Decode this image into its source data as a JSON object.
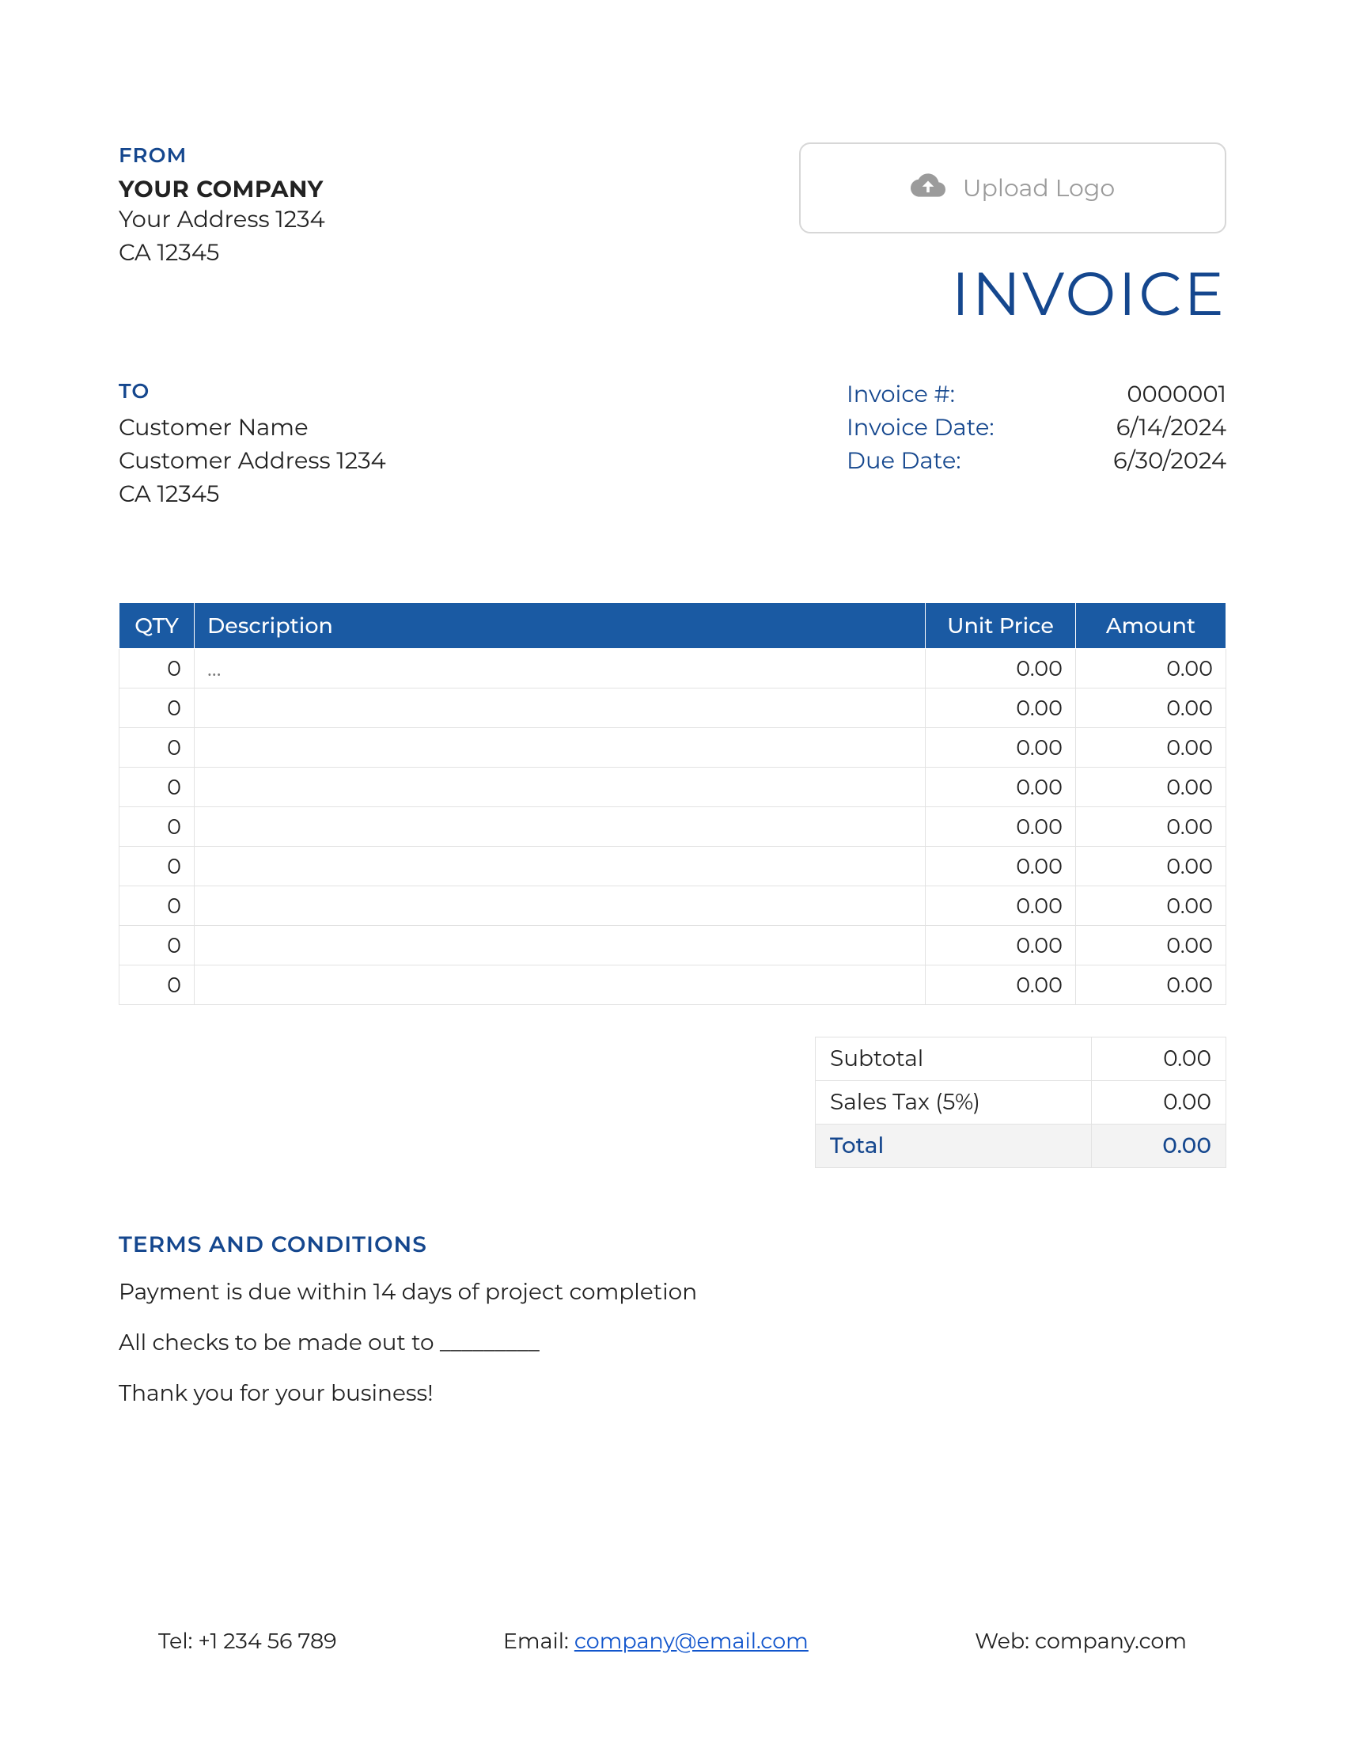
{
  "from": {
    "label": "FROM",
    "company": "YOUR COMPANY",
    "address": "Your Address 1234",
    "city": "CA 12345"
  },
  "logo": {
    "upload_label": "Upload Logo"
  },
  "doc_title": "INVOICE",
  "to": {
    "label": "TO",
    "name": "Customer Name",
    "address": "Customer Address 1234",
    "city": "CA 12345"
  },
  "meta": {
    "invoice_no_label": "Invoice #:",
    "invoice_no": "0000001",
    "invoice_date_label": "Invoice Date:",
    "invoice_date": "6/14/2024",
    "due_date_label": "Due Date:",
    "due_date": "6/30/2024"
  },
  "table": {
    "headers": {
      "qty": "QTY",
      "desc": "Description",
      "unit": "Unit Price",
      "amount": "Amount"
    },
    "rows": [
      {
        "qty": "0",
        "desc": "…",
        "unit": "0.00",
        "amount": "0.00"
      },
      {
        "qty": "0",
        "desc": "",
        "unit": "0.00",
        "amount": "0.00"
      },
      {
        "qty": "0",
        "desc": "",
        "unit": "0.00",
        "amount": "0.00"
      },
      {
        "qty": "0",
        "desc": "",
        "unit": "0.00",
        "amount": "0.00"
      },
      {
        "qty": "0",
        "desc": "",
        "unit": "0.00",
        "amount": "0.00"
      },
      {
        "qty": "0",
        "desc": "",
        "unit": "0.00",
        "amount": "0.00"
      },
      {
        "qty": "0",
        "desc": "",
        "unit": "0.00",
        "amount": "0.00"
      },
      {
        "qty": "0",
        "desc": "",
        "unit": "0.00",
        "amount": "0.00"
      },
      {
        "qty": "0",
        "desc": "",
        "unit": "0.00",
        "amount": "0.00"
      }
    ]
  },
  "totals": {
    "subtotal_label": "Subtotal",
    "subtotal": "0.00",
    "tax_label": "Sales Tax (5%)",
    "tax": "0.00",
    "total_label": "Total",
    "total": "0.00"
  },
  "terms": {
    "label": "TERMS AND CONDITIONS",
    "line1": "Payment is due within 14 days of project completion",
    "line2": "All checks to be made out to _________",
    "line3": "Thank you for your business!"
  },
  "footer": {
    "tel_label": "Tel: ",
    "tel": "+1 234 56 789",
    "email_label": "Email: ",
    "email": "company@email.com",
    "web_label": "Web: ",
    "web": "company.com"
  }
}
